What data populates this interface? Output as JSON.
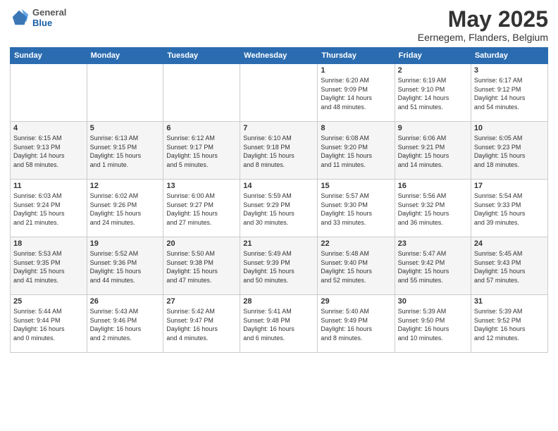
{
  "header": {
    "logo_general": "General",
    "logo_blue": "Blue",
    "month_title": "May 2025",
    "location": "Eernegem, Flanders, Belgium"
  },
  "weekdays": [
    "Sunday",
    "Monday",
    "Tuesday",
    "Wednesday",
    "Thursday",
    "Friday",
    "Saturday"
  ],
  "weeks": [
    [
      {
        "day": "",
        "info": ""
      },
      {
        "day": "",
        "info": ""
      },
      {
        "day": "",
        "info": ""
      },
      {
        "day": "",
        "info": ""
      },
      {
        "day": "1",
        "info": "Sunrise: 6:20 AM\nSunset: 9:09 PM\nDaylight: 14 hours\nand 48 minutes."
      },
      {
        "day": "2",
        "info": "Sunrise: 6:19 AM\nSunset: 9:10 PM\nDaylight: 14 hours\nand 51 minutes."
      },
      {
        "day": "3",
        "info": "Sunrise: 6:17 AM\nSunset: 9:12 PM\nDaylight: 14 hours\nand 54 minutes."
      }
    ],
    [
      {
        "day": "4",
        "info": "Sunrise: 6:15 AM\nSunset: 9:13 PM\nDaylight: 14 hours\nand 58 minutes."
      },
      {
        "day": "5",
        "info": "Sunrise: 6:13 AM\nSunset: 9:15 PM\nDaylight: 15 hours\nand 1 minute."
      },
      {
        "day": "6",
        "info": "Sunrise: 6:12 AM\nSunset: 9:17 PM\nDaylight: 15 hours\nand 5 minutes."
      },
      {
        "day": "7",
        "info": "Sunrise: 6:10 AM\nSunset: 9:18 PM\nDaylight: 15 hours\nand 8 minutes."
      },
      {
        "day": "8",
        "info": "Sunrise: 6:08 AM\nSunset: 9:20 PM\nDaylight: 15 hours\nand 11 minutes."
      },
      {
        "day": "9",
        "info": "Sunrise: 6:06 AM\nSunset: 9:21 PM\nDaylight: 15 hours\nand 14 minutes."
      },
      {
        "day": "10",
        "info": "Sunrise: 6:05 AM\nSunset: 9:23 PM\nDaylight: 15 hours\nand 18 minutes."
      }
    ],
    [
      {
        "day": "11",
        "info": "Sunrise: 6:03 AM\nSunset: 9:24 PM\nDaylight: 15 hours\nand 21 minutes."
      },
      {
        "day": "12",
        "info": "Sunrise: 6:02 AM\nSunset: 9:26 PM\nDaylight: 15 hours\nand 24 minutes."
      },
      {
        "day": "13",
        "info": "Sunrise: 6:00 AM\nSunset: 9:27 PM\nDaylight: 15 hours\nand 27 minutes."
      },
      {
        "day": "14",
        "info": "Sunrise: 5:59 AM\nSunset: 9:29 PM\nDaylight: 15 hours\nand 30 minutes."
      },
      {
        "day": "15",
        "info": "Sunrise: 5:57 AM\nSunset: 9:30 PM\nDaylight: 15 hours\nand 33 minutes."
      },
      {
        "day": "16",
        "info": "Sunrise: 5:56 AM\nSunset: 9:32 PM\nDaylight: 15 hours\nand 36 minutes."
      },
      {
        "day": "17",
        "info": "Sunrise: 5:54 AM\nSunset: 9:33 PM\nDaylight: 15 hours\nand 39 minutes."
      }
    ],
    [
      {
        "day": "18",
        "info": "Sunrise: 5:53 AM\nSunset: 9:35 PM\nDaylight: 15 hours\nand 41 minutes."
      },
      {
        "day": "19",
        "info": "Sunrise: 5:52 AM\nSunset: 9:36 PM\nDaylight: 15 hours\nand 44 minutes."
      },
      {
        "day": "20",
        "info": "Sunrise: 5:50 AM\nSunset: 9:38 PM\nDaylight: 15 hours\nand 47 minutes."
      },
      {
        "day": "21",
        "info": "Sunrise: 5:49 AM\nSunset: 9:39 PM\nDaylight: 15 hours\nand 50 minutes."
      },
      {
        "day": "22",
        "info": "Sunrise: 5:48 AM\nSunset: 9:40 PM\nDaylight: 15 hours\nand 52 minutes."
      },
      {
        "day": "23",
        "info": "Sunrise: 5:47 AM\nSunset: 9:42 PM\nDaylight: 15 hours\nand 55 minutes."
      },
      {
        "day": "24",
        "info": "Sunrise: 5:45 AM\nSunset: 9:43 PM\nDaylight: 15 hours\nand 57 minutes."
      }
    ],
    [
      {
        "day": "25",
        "info": "Sunrise: 5:44 AM\nSunset: 9:44 PM\nDaylight: 16 hours\nand 0 minutes."
      },
      {
        "day": "26",
        "info": "Sunrise: 5:43 AM\nSunset: 9:46 PM\nDaylight: 16 hours\nand 2 minutes."
      },
      {
        "day": "27",
        "info": "Sunrise: 5:42 AM\nSunset: 9:47 PM\nDaylight: 16 hours\nand 4 minutes."
      },
      {
        "day": "28",
        "info": "Sunrise: 5:41 AM\nSunset: 9:48 PM\nDaylight: 16 hours\nand 6 minutes."
      },
      {
        "day": "29",
        "info": "Sunrise: 5:40 AM\nSunset: 9:49 PM\nDaylight: 16 hours\nand 8 minutes."
      },
      {
        "day": "30",
        "info": "Sunrise: 5:39 AM\nSunset: 9:50 PM\nDaylight: 16 hours\nand 10 minutes."
      },
      {
        "day": "31",
        "info": "Sunrise: 5:39 AM\nSunset: 9:52 PM\nDaylight: 16 hours\nand 12 minutes."
      }
    ]
  ]
}
